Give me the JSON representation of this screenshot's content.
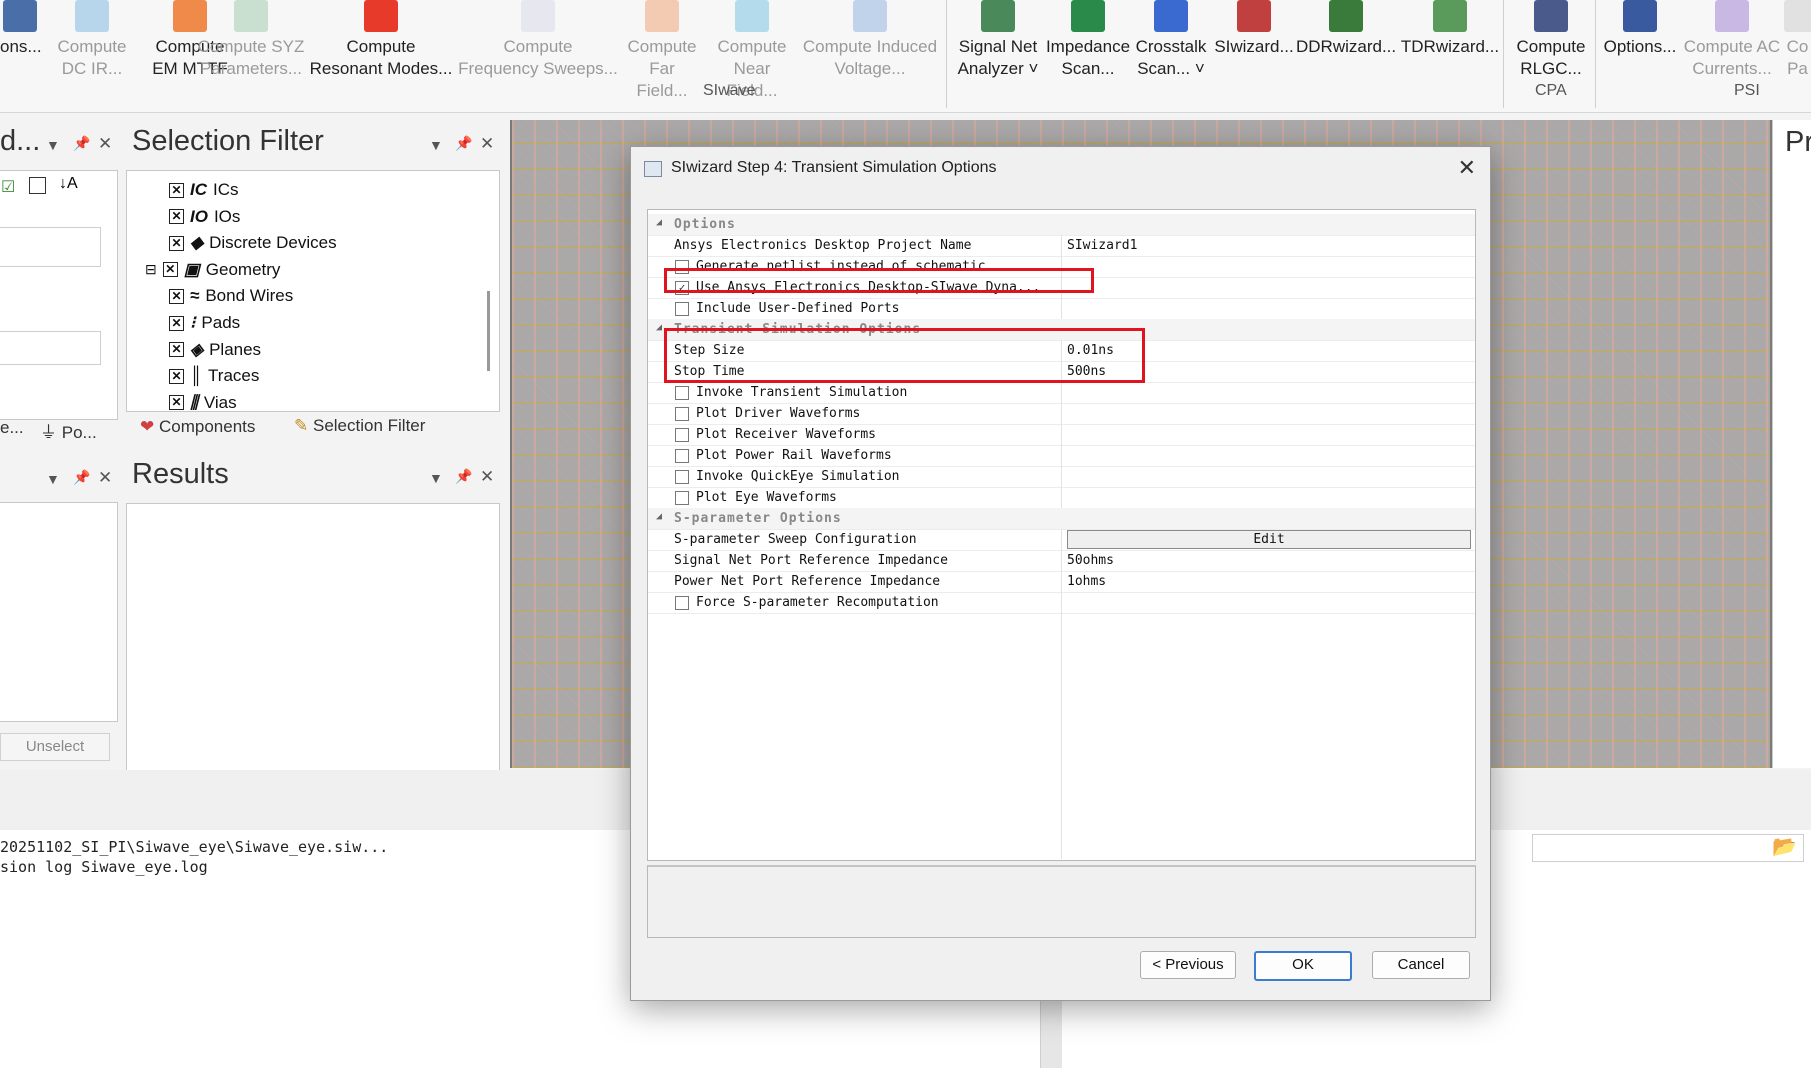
{
  "ribbon": {
    "buttons": [
      {
        "l1": "ons...",
        "l2": "",
        "disabled": false,
        "color": "#4a6fa8"
      },
      {
        "l1": "Compute",
        "l2": "DC IR...",
        "disabled": true,
        "color": "#7ab6e0"
      },
      {
        "l1": "Compute",
        "l2": "EM MTTF",
        "disabled": false,
        "color": "#f08a4a"
      },
      {
        "l1": "Compute SYZ",
        "l2": "Parameters...",
        "disabled": true,
        "color": "#9cc7a8"
      },
      {
        "l1": "Compute",
        "l2": "Resonant Modes...",
        "disabled": false,
        "color": "#e83a2a"
      },
      {
        "l1": "Compute",
        "l2": "Frequency Sweeps...",
        "disabled": true,
        "color": "#d5d8e8"
      },
      {
        "l1": "Compute",
        "l2": "Far Field...",
        "disabled": true,
        "color": "#f0a070"
      },
      {
        "l1": "Compute",
        "l2": "Near Field...",
        "disabled": true,
        "color": "#70c0e0"
      },
      {
        "l1": "Compute Induced",
        "l2": "Voltage...",
        "disabled": true,
        "color": "#8ab0e0"
      },
      {
        "l1": "Signal Net",
        "l2": "Analyzer ˅",
        "disabled": false,
        "color": "#4a8a5a"
      },
      {
        "l1": "Impedance",
        "l2": "Scan...",
        "disabled": false,
        "color": "#2a8a4a"
      },
      {
        "l1": "Crosstalk",
        "l2": "Scan... ˅",
        "disabled": false,
        "color": "#3a6ad0"
      },
      {
        "l1": "SIwizard...",
        "l2": "",
        "disabled": false,
        "color": "#c04040"
      },
      {
        "l1": "DDRwizard...",
        "l2": "",
        "disabled": false,
        "color": "#3a7a3a"
      },
      {
        "l1": "TDRwizard...",
        "l2": "",
        "disabled": false,
        "color": "#5a9a5a"
      },
      {
        "l1": "Compute",
        "l2": "RLGC...",
        "disabled": false,
        "color": "#4a5a8a"
      },
      {
        "l1": "Options...",
        "l2": "",
        "disabled": false,
        "color": "#3a5aa0"
      },
      {
        "l1": "Compute AC",
        "l2": "Currents...",
        "disabled": true,
        "color": "#9a7ad0"
      },
      {
        "l1": "Co",
        "l2": "Pa",
        "disabled": true,
        "color": "#cccccc"
      }
    ],
    "groups": {
      "siwave": "SIwave",
      "cpa": "CPA",
      "psi": "PSI"
    }
  },
  "left_panel": {
    "title": "d...",
    "unselect": "Unselect",
    "tab1": "e...",
    "tab2": "Po..."
  },
  "selection_filter": {
    "title": "Selection Filter",
    "items": [
      {
        "icon": "IC",
        "label": "ICs"
      },
      {
        "icon": "IO",
        "label": "IOs"
      },
      {
        "icon": "◆",
        "label": "Discrete Devices"
      },
      {
        "icon": "▣",
        "label": "Geometry"
      },
      {
        "icon": "≈",
        "label": "Bond Wires"
      },
      {
        "icon": "⁝",
        "label": "Pads"
      },
      {
        "icon": "◈",
        "label": "Planes"
      },
      {
        "icon": "║",
        "label": "Traces"
      },
      {
        "icon": "⫼",
        "label": "Vias"
      }
    ],
    "tabs": {
      "components": "Components",
      "selection_filter": "Selection Filter"
    }
  },
  "results": {
    "title": "Results"
  },
  "right_panel": {
    "title": "Pr"
  },
  "dialog": {
    "title": "SIwizard Step 4: Transient Simulation Options",
    "categories": {
      "options": "Options",
      "transient": "Transient Simulation Options",
      "sparam": "S-parameter Options"
    },
    "options": {
      "project_name_label": "Ansys Electronics Desktop Project Name",
      "project_name_value": "SIwizard1",
      "generate_netlist": "Generate netlist instead of schematic",
      "use_aedt": "Use Ansys Electronics Desktop-SIwave Dyna...",
      "include_ports": "Include User-Defined Ports"
    },
    "transient": {
      "step_size_label": "Step Size",
      "step_size_value": "0.01ns",
      "stop_time_label": "Stop Time",
      "stop_time_value": "500ns",
      "invoke_transient": "Invoke Transient Simulation",
      "plot_driver": "Plot Driver Waveforms",
      "plot_receiver": "Plot Receiver Waveforms",
      "plot_power": "Plot Power Rail Waveforms",
      "invoke_quickeye": "Invoke QuickEye Simulation",
      "plot_eye": "Plot Eye Waveforms"
    },
    "sparam": {
      "sweep_label": "S-parameter Sweep Configuration",
      "sweep_button": "Edit",
      "signal_ref_label": "Signal Net Port Reference Impedance",
      "signal_ref_value": "50ohms",
      "power_ref_label": "Power Net Port Reference Impedance",
      "power_ref_value": "1ohms",
      "force_recompute": "Force S-parameter Recomputation"
    },
    "buttons": {
      "previous": "< Previous",
      "ok": "OK",
      "cancel": "Cancel"
    }
  },
  "console": {
    "line1": "20251102_SI_PI\\Siwave_eye\\Siwave_eye.siw...",
    "line2": "sion log Siwave_eye.log"
  }
}
